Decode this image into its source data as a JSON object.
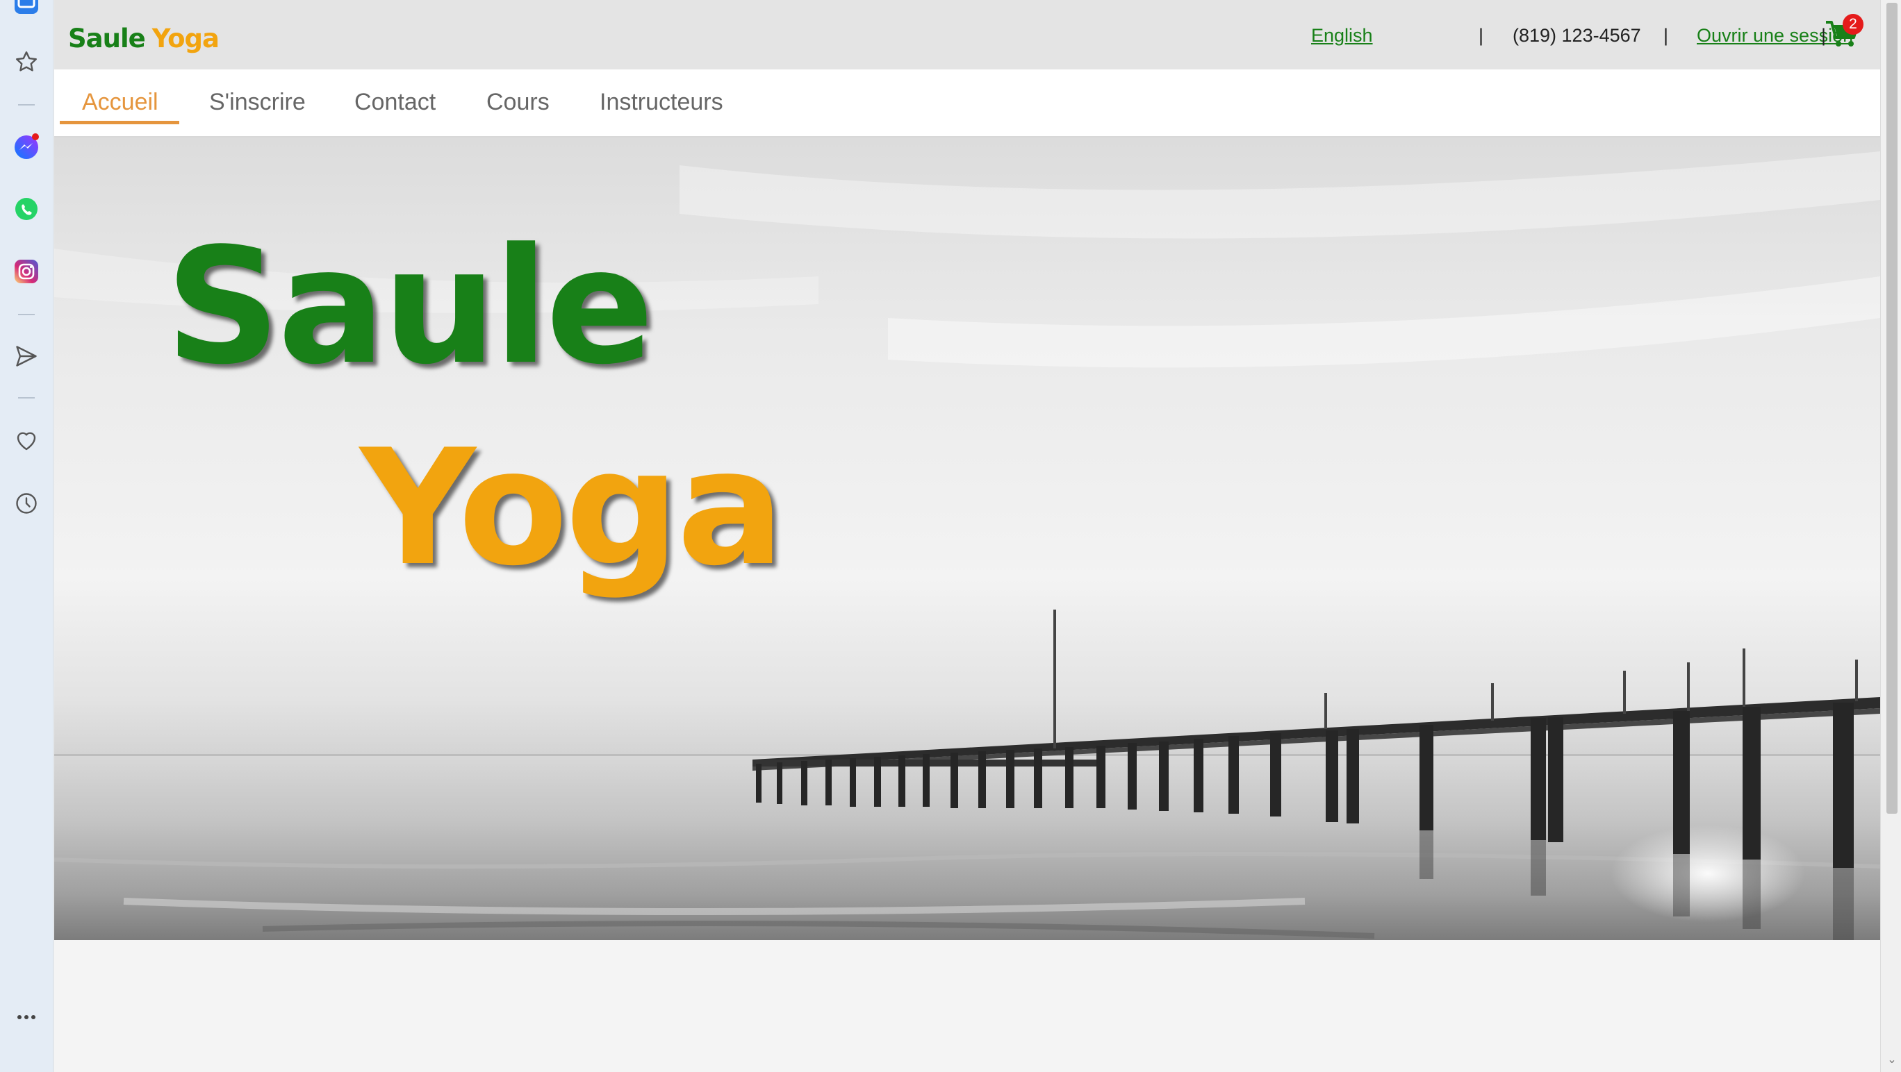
{
  "sidebar": {
    "icons": [
      "tab-icon",
      "star-icon",
      "messenger-icon",
      "whatsapp-icon",
      "instagram-icon",
      "send-icon",
      "heart-icon",
      "clock-icon",
      "more-icon"
    ]
  },
  "header": {
    "logo_word1": "Saule",
    "logo_word2": "Yoga",
    "language_link": "English",
    "separator": "|",
    "phone": "(819) 123-4567",
    "login_link": "Ouvrir une session",
    "cart_count": "2"
  },
  "nav": {
    "items": [
      {
        "label": "Accueil"
      },
      {
        "label": "S'inscrire"
      },
      {
        "label": "Contact"
      },
      {
        "label": "Cours"
      },
      {
        "label": "Instructeurs"
      }
    ],
    "active_index": 0
  },
  "hero": {
    "title_line1": "Saule",
    "title_line2": "Yoga"
  },
  "colors": {
    "brand_green": "#188018",
    "brand_orange": "#f2a40f",
    "nav_active": "#e5953d",
    "badge_red": "#e51b1b"
  }
}
